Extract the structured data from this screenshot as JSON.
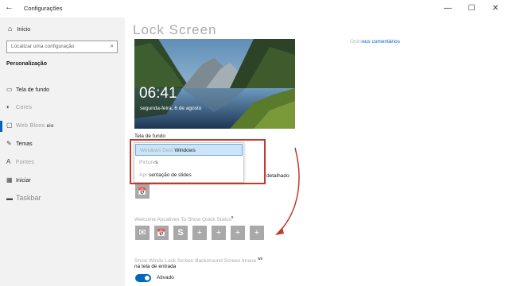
{
  "window": {
    "title": "Configurações",
    "back_icon": "back-arrow-icon",
    "controls": [
      "—",
      "☐",
      "✕"
    ]
  },
  "sidebar": {
    "home_label": "Início",
    "search_placeholder": "Localizar uma configuração",
    "section_title": "Personalização",
    "items": [
      {
        "label": "Tela de fundo",
        "icon": "image-icon"
      },
      {
        "label": "Cores",
        "icon": "palette-icon"
      },
      {
        "label": "Web Bloos",
        "suffix": "eio",
        "icon": "lock-screen-icon"
      },
      {
        "label": "Temas",
        "icon": "brush-icon"
      },
      {
        "label": "Fontes",
        "icon": "font-icon"
      },
      {
        "label": "Iniciar",
        "icon": "start-icon"
      },
      {
        "label": "Taskbar",
        "icon": "taskbar-icon"
      }
    ]
  },
  "main": {
    "title": "Lock Screen",
    "help_faint": "Opini",
    "help_link": "eus comentários",
    "lock_time": "06:41",
    "lock_date": "segunda-feira, 6 de agosto",
    "background_label": "Tela de fundo",
    "dropdown_options": [
      {
        "faint": "Windows Dest",
        "text": "Windows",
        "selected": true
      },
      {
        "faint": "Picture",
        "text": "s",
        "selected": false
      },
      {
        "faint": "Apr",
        "text": "sentação de slides",
        "selected": false
      }
    ],
    "detailed_text": "detalhado",
    "quick_status_label": "Welcome Apcatives To Show Quick Status",
    "quick_status_suffix": "s",
    "quick_tiles": [
      "✉",
      "📅",
      "S",
      "+",
      "+",
      "+",
      "+"
    ],
    "show_bg_label": "Show Windo Lock Screen Backoround Screen Imaoe",
    "show_bg_suffix": "ws",
    "show_bg_line2": "na tela de entrada",
    "toggle_label": "Ativado",
    "toggle_on": true
  },
  "colors": {
    "accent": "#0067c0",
    "highlight_box": "#c0392b",
    "sidebar_bg": "#f2f2f2",
    "tile_bg": "#a9a9a9"
  }
}
